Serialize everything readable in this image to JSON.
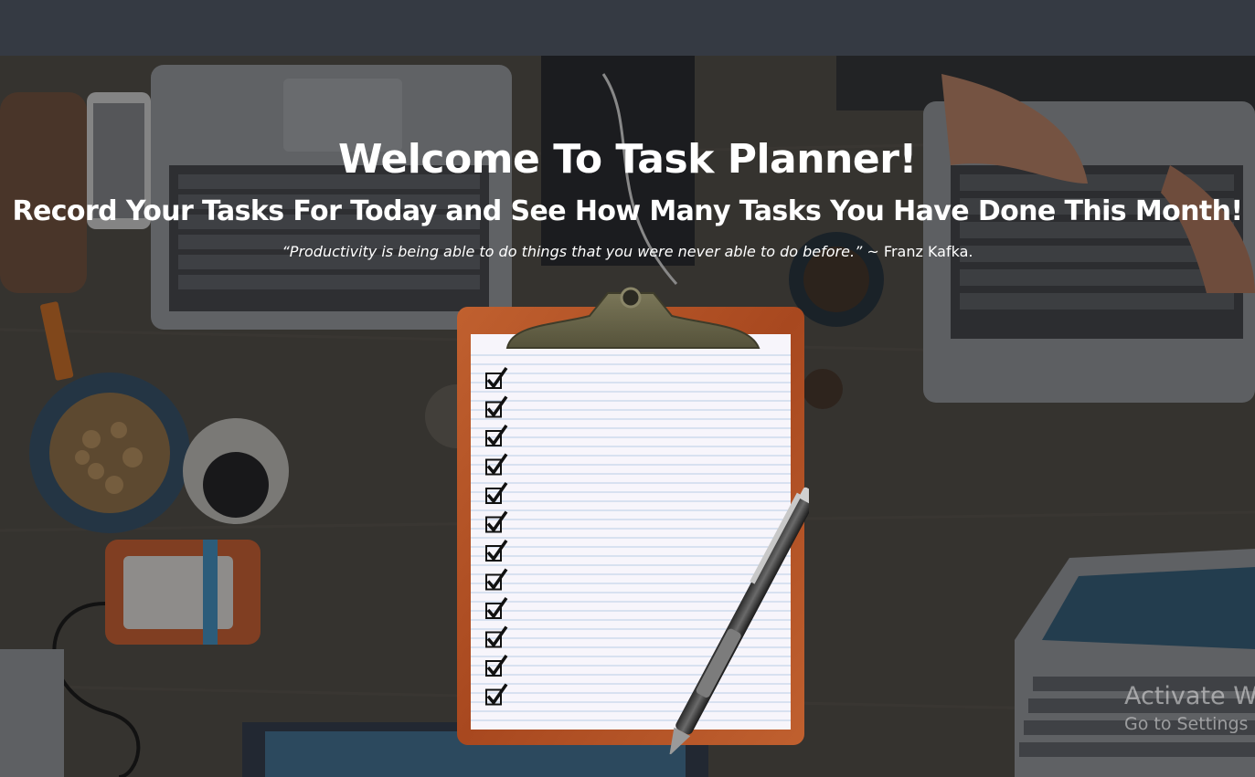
{
  "hero": {
    "title": "Welcome To Task Planner!",
    "subtitle": "Record Your Tasks For Today and See How Many Tasks You Have Done This Month!",
    "quote_text": "“Productivity is being able to do things that you were never able to do before.”",
    "quote_author": " ~ Franz Kafka."
  },
  "watermark": {
    "title": "Activate W",
    "subtitle": "Go to Settings"
  },
  "colors": {
    "navbar": "#353a43",
    "clipboard_board": "#b5542a",
    "clip_metal": "#6b6848",
    "text": "#ffffff"
  },
  "illustration": {
    "checkbox_count": 12
  }
}
